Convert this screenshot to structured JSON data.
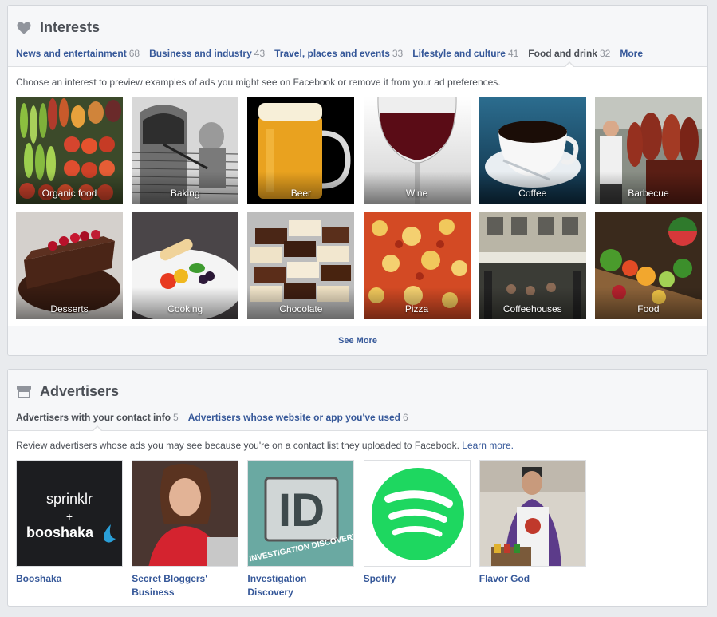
{
  "interests": {
    "title": "Interests",
    "icon": "heart-icon",
    "tabs": [
      {
        "label": "News and entertainment",
        "count": "68"
      },
      {
        "label": "Business and industry",
        "count": "43"
      },
      {
        "label": "Travel, places and events",
        "count": "33"
      },
      {
        "label": "Lifestyle and culture",
        "count": "41"
      },
      {
        "label": "Food and drink",
        "count": "32",
        "active": true
      },
      {
        "label": "More",
        "count": ""
      }
    ],
    "description": "Choose an interest to preview examples of ads you might see on Facebook or remove it from your ad preferences.",
    "tiles": [
      {
        "label": "Organic food"
      },
      {
        "label": "Baking"
      },
      {
        "label": "Beer"
      },
      {
        "label": "Wine"
      },
      {
        "label": "Coffee"
      },
      {
        "label": "Barbecue"
      },
      {
        "label": "Desserts"
      },
      {
        "label": "Cooking"
      },
      {
        "label": "Chocolate"
      },
      {
        "label": "Pizza"
      },
      {
        "label": "Coffeehouses"
      },
      {
        "label": "Food"
      }
    ],
    "see_more": "See More"
  },
  "advertisers": {
    "title": "Advertisers",
    "icon": "storefront-icon",
    "tabs": [
      {
        "label": "Advertisers with your contact info",
        "count": "5",
        "active": true
      },
      {
        "label": "Advertisers whose website or app you've used",
        "count": "6"
      }
    ],
    "description": "Review advertisers whose ads you may see because you're on a contact list they uploaded to Facebook.",
    "learn_more": "Learn more.",
    "items": [
      {
        "name": "Booshaka",
        "logo_top": "sprinklr",
        "logo_plus": "+",
        "logo_bottom": "booshaka"
      },
      {
        "name": "Secret Bloggers' Business"
      },
      {
        "name": "Investigation Discovery",
        "logo": "ID",
        "logo_sub": "INVESTIGATION DISCOVERY"
      },
      {
        "name": "Spotify"
      },
      {
        "name": "Flavor God"
      }
    ]
  },
  "colors": {
    "link": "#365899",
    "background": "#e9ebee",
    "spotify_green": "#1ed760"
  }
}
